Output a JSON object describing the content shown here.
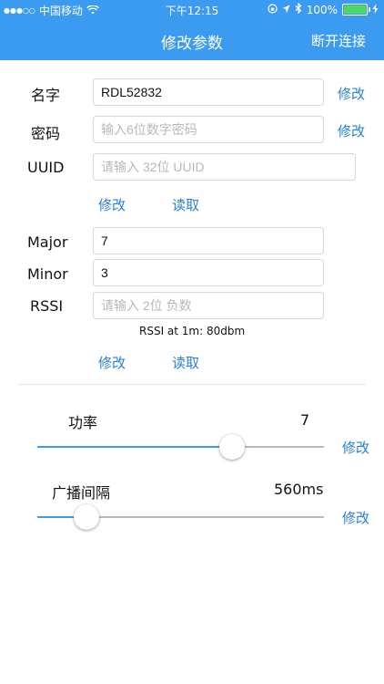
{
  "status_bar": {
    "carrier": "中国移动",
    "time": "下午12:15",
    "battery": "100%"
  },
  "nav": {
    "title": "修改参数",
    "disconnect": "断开连接"
  },
  "form": {
    "name": {
      "label": "名字",
      "value": "RDL52832",
      "action": "修改"
    },
    "password": {
      "label": "密码",
      "placeholder": "输入6位数字密码",
      "action": "修改"
    },
    "uuid": {
      "label": "UUID",
      "placeholder": "请输入 32位 UUID",
      "modify": "修改",
      "read": "读取"
    },
    "major": {
      "label": "Major",
      "value": "7"
    },
    "minor": {
      "label": "Minor",
      "value": "3"
    },
    "rssi": {
      "label": "RSSI",
      "placeholder": "请输入 2位 负数",
      "note": "RSSI at 1m: 80dbm",
      "modify": "修改",
      "read": "读取"
    }
  },
  "power": {
    "label": "功率",
    "value": "7",
    "level_fraction": 0.68,
    "action": "修改"
  },
  "interval": {
    "label": "广播间隔",
    "value": "560ms",
    "level_fraction": 0.17,
    "action": "修改"
  },
  "colors": {
    "accent": "#3a9bf0",
    "link": "#2a7fd6"
  }
}
